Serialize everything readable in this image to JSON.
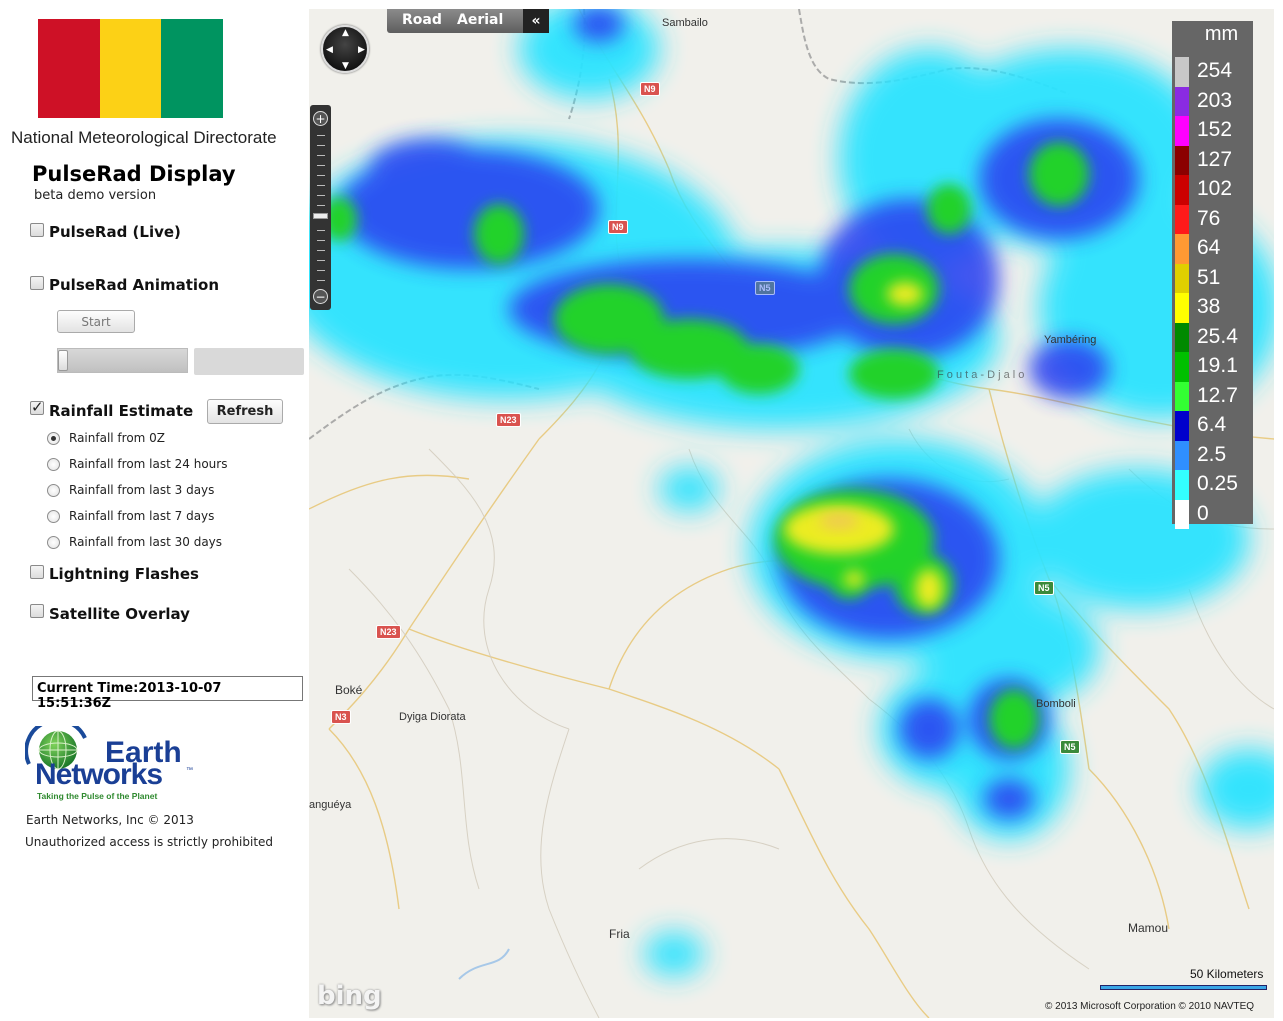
{
  "colors": {
    "flag_red": "#ce1126",
    "flag_yellow": "#fcd116",
    "flag_green": "#009460",
    "legend_bg": "#666666",
    "rain_light": "#29e3ff",
    "rain_blue": "#2a3cf0",
    "rain_green": "#22d22a"
  },
  "sidebar": {
    "organization": "National Meteorological Directorate",
    "title": "PulseRad Display",
    "subtitle": "beta demo version",
    "layers": {
      "live": {
        "label": "PulseRad (Live)",
        "checked": false
      },
      "animation": {
        "label": "PulseRad Animation",
        "checked": false,
        "start_label": "Start"
      },
      "rainfall": {
        "label": "Rainfall Estimate",
        "checked": true,
        "refresh_label": "Refresh"
      },
      "lightning": {
        "label": "Lightning Flashes",
        "checked": false
      },
      "satellite": {
        "label": "Satellite Overlay",
        "checked": false
      }
    },
    "rainfall_options": [
      {
        "label": "Rainfall from 0Z",
        "selected": true
      },
      {
        "label": "Rainfall from last 24 hours",
        "selected": false
      },
      {
        "label": "Rainfall from last 3 days",
        "selected": false
      },
      {
        "label": "Rainfall from last 7 days",
        "selected": false
      },
      {
        "label": "Rainfall from last 30 days",
        "selected": false
      }
    ],
    "current_time": "Current Time:2013-10-07 15:51:36Z",
    "logo": {
      "line1": "Earth",
      "line2": "Networks",
      "tm": "™",
      "tagline": "Taking the Pulse of the Planet"
    },
    "copyright": "Earth Networks, Inc © 2013",
    "notice": "Unauthorized access is strictly prohibited"
  },
  "map": {
    "view_road": "Road",
    "view_aerial": "Aerial",
    "collapse_icon": "double-chevron-left-icon",
    "collapse_glyph": "«",
    "zoom_in": "+",
    "zoom_out": "−",
    "legend": {
      "unit": "mm",
      "entries": [
        {
          "value": "254",
          "color": "#c8c8c8"
        },
        {
          "value": "203",
          "color": "#8a2be2"
        },
        {
          "value": "152",
          "color": "#ff00ff"
        },
        {
          "value": "127",
          "color": "#8b0000"
        },
        {
          "value": "102",
          "color": "#cc0000"
        },
        {
          "value": "76",
          "color": "#ff1a1a"
        },
        {
          "value": "64",
          "color": "#ff9933"
        },
        {
          "value": "51",
          "color": "#e0d000"
        },
        {
          "value": "38",
          "color": "#ffff00"
        },
        {
          "value": "25.4",
          "color": "#008a00"
        },
        {
          "value": "19.1",
          "color": "#00c000"
        },
        {
          "value": "12.7",
          "color": "#33ff33"
        },
        {
          "value": "6.4",
          "color": "#0000cc"
        },
        {
          "value": "2.5",
          "color": "#2f8fff"
        },
        {
          "value": "0.25",
          "color": "#33ffff"
        },
        {
          "value": "0",
          "color": "#ffffff"
        }
      ]
    },
    "places": {
      "sambailo": "Sambailo",
      "yambering": "Yambéring",
      "fouta": "F o u t a - D j a l o",
      "boke": "Boké",
      "dyiga": "Dyiga Diorata",
      "bomboli": "Bomboli",
      "tanguea": "anguéya",
      "fria": "Fria",
      "mamou": "Mamou"
    },
    "roads": {
      "n9": "N9",
      "n9b": "N9",
      "n5a": "N5",
      "n5b": "N5",
      "n5c": "N5",
      "n23a": "N23",
      "n23b": "N23",
      "n3": "N3"
    },
    "scale": "50 Kilometers",
    "attribution": "© 2013 Microsoft Corporation   © 2010 NAVTEQ",
    "provider": "bing"
  }
}
